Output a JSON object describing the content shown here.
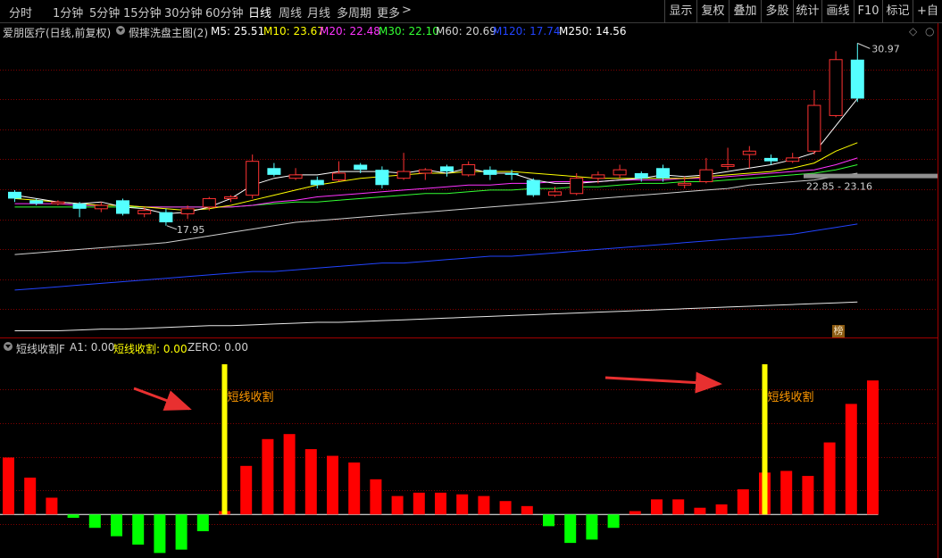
{
  "toolbar": {
    "periods": [
      "分时",
      "1分钟",
      "5分钟",
      "15分钟",
      "30分钟",
      "60分钟",
      "日线",
      "周线",
      "月线",
      "多周期",
      "更多"
    ],
    "active_period": "日线",
    "more_arrow": ">",
    "right_buttons": [
      "显示",
      "复权",
      "叠加",
      "多股",
      "统计",
      "画线",
      "F10",
      "标记",
      "+自选"
    ]
  },
  "main_header": {
    "stock": "爱朋医疗(日线,前复权)",
    "indicator": "假摔洗盘主图(2)",
    "ma": [
      {
        "label": "M5: 25.51",
        "color": "#ffffff"
      },
      {
        "label": "M10: 23.67",
        "color": "#ffff00"
      },
      {
        "label": "M20: 22.48",
        "color": "#ff33ff"
      },
      {
        "label": "M30: 22.10",
        "color": "#33ff33"
      },
      {
        "label": "M60: 20.69",
        "color": "#d0d0d0"
      },
      {
        "label": "M120: 17.74",
        "color": "#2244ff"
      },
      {
        "label": "M250: 14.56",
        "color": "#ffffff"
      }
    ],
    "collapse_icon": "diamond-icon"
  },
  "price_labels": {
    "high": "30.97",
    "low": "17.95",
    "range": "22.85 - 23.16",
    "badge": "榜"
  },
  "sub_header": {
    "name": "短线收割F",
    "a1": "A1: 0.00",
    "sx": "短线收割: 0.00",
    "zero": "ZERO: 0.00"
  },
  "signal_label": "短线收割",
  "colors": {
    "up": "#ff3232",
    "down": "#54ffff",
    "macd_up": "#ff0000",
    "macd_down": "#00ff00",
    "signal": "#ffff00",
    "grid": "#800000"
  },
  "chart_data": {
    "type": "candlestick",
    "candles": [
      {
        "o": 22.2,
        "c": 21.8,
        "h": 22.3,
        "l": 21.6
      },
      {
        "o": 21.7,
        "c": 21.5,
        "h": 21.8,
        "l": 21.4
      },
      {
        "o": 21.5,
        "c": 21.6,
        "h": 21.7,
        "l": 21.4
      },
      {
        "o": 21.5,
        "c": 21.2,
        "h": 21.6,
        "l": 20.7
      },
      {
        "o": 21.2,
        "c": 21.4,
        "h": 21.6,
        "l": 21.0
      },
      {
        "o": 21.7,
        "c": 20.9,
        "h": 21.8,
        "l": 20.8
      },
      {
        "o": 20.9,
        "c": 21.1,
        "h": 21.3,
        "l": 20.7
      },
      {
        "o": 21.0,
        "c": 20.4,
        "h": 21.2,
        "l": 20.2
      },
      {
        "o": 20.9,
        "c": 21.2,
        "h": 21.4,
        "l": 20.6
      },
      {
        "o": 21.3,
        "c": 21.8,
        "h": 21.9,
        "l": 21.1
      },
      {
        "o": 21.8,
        "c": 21.9,
        "h": 22.0,
        "l": 21.6
      },
      {
        "o": 22.0,
        "c": 24.0,
        "h": 24.4,
        "l": 21.8
      },
      {
        "o": 23.6,
        "c": 23.2,
        "h": 23.9,
        "l": 23.1
      },
      {
        "o": 23.0,
        "c": 23.2,
        "h": 23.6,
        "l": 22.9
      },
      {
        "o": 22.9,
        "c": 22.6,
        "h": 23.1,
        "l": 22.4
      },
      {
        "o": 22.9,
        "c": 23.3,
        "h": 24.0,
        "l": 22.8
      },
      {
        "o": 23.8,
        "c": 23.5,
        "h": 23.9,
        "l": 23.3
      },
      {
        "o": 23.5,
        "c": 22.6,
        "h": 23.7,
        "l": 22.4
      },
      {
        "o": 23.0,
        "c": 23.4,
        "h": 24.5,
        "l": 22.9
      },
      {
        "o": 23.3,
        "c": 23.5,
        "h": 23.6,
        "l": 22.9
      },
      {
        "o": 23.7,
        "c": 23.4,
        "h": 23.8,
        "l": 23.1
      },
      {
        "o": 23.2,
        "c": 23.8,
        "h": 24.0,
        "l": 23.1
      },
      {
        "o": 23.5,
        "c": 23.2,
        "h": 23.7,
        "l": 22.9
      },
      {
        "o": 23.3,
        "c": 23.2,
        "h": 23.5,
        "l": 22.9
      },
      {
        "o": 22.9,
        "c": 22.0,
        "h": 23.0,
        "l": 21.9
      },
      {
        "o": 22.0,
        "c": 22.2,
        "h": 22.5,
        "l": 21.9
      },
      {
        "o": 22.1,
        "c": 23.0,
        "h": 23.3,
        "l": 22.0
      },
      {
        "o": 23.0,
        "c": 23.2,
        "h": 23.4,
        "l": 22.7
      },
      {
        "o": 23.2,
        "c": 23.5,
        "h": 23.8,
        "l": 23.0
      },
      {
        "o": 23.3,
        "c": 23.0,
        "h": 23.4,
        "l": 22.8
      },
      {
        "o": 23.6,
        "c": 23.0,
        "h": 23.8,
        "l": 22.8
      },
      {
        "o": 22.6,
        "c": 22.7,
        "h": 23.1,
        "l": 22.4
      },
      {
        "o": 22.8,
        "c": 23.5,
        "h": 24.2,
        "l": 22.7
      },
      {
        "o": 23.7,
        "c": 23.8,
        "h": 24.8,
        "l": 23.5
      },
      {
        "o": 24.4,
        "c": 24.6,
        "h": 24.9,
        "l": 23.6
      },
      {
        "o": 24.2,
        "c": 24.0,
        "h": 24.4,
        "l": 23.8
      },
      {
        "o": 24.0,
        "c": 24.2,
        "h": 24.5,
        "l": 23.9
      },
      {
        "o": 24.6,
        "c": 27.3,
        "h": 28.2,
        "l": 24.4
      },
      {
        "o": 26.7,
        "c": 30.0,
        "h": 30.5,
        "l": 26.6
      },
      {
        "o": 30.0,
        "c": 27.7,
        "h": 30.97,
        "l": 27.5
      }
    ],
    "ma5": [
      22.0,
      21.8,
      21.6,
      21.5,
      21.6,
      21.3,
      21.2,
      20.9,
      21.0,
      21.3,
      21.8,
      22.6,
      23.0,
      23.2,
      23.2,
      23.4,
      23.4,
      23.4,
      23.3,
      23.5,
      23.3,
      23.6,
      23.3,
      23.3,
      22.9,
      22.7,
      22.7,
      22.8,
      22.9,
      23.0,
      23.2,
      23.1,
      23.2,
      23.4,
      23.6,
      23.8,
      24.1,
      24.5,
      26.1,
      27.7
    ],
    "ma10": [
      21.8,
      21.7,
      21.6,
      21.5,
      21.4,
      21.4,
      21.3,
      21.2,
      21.1,
      21.2,
      21.4,
      21.7,
      22.0,
      22.3,
      22.6,
      22.8,
      23.0,
      23.1,
      23.2,
      23.3,
      23.3,
      23.4,
      23.4,
      23.4,
      23.3,
      23.2,
      23.1,
      23.0,
      23.0,
      23.0,
      23.0,
      23.0,
      23.1,
      23.2,
      23.3,
      23.4,
      23.6,
      23.9,
      24.6,
      25.1
    ],
    "ma20": [
      21.5,
      21.5,
      21.5,
      21.4,
      21.4,
      21.4,
      21.3,
      21.3,
      21.3,
      21.3,
      21.3,
      21.4,
      21.6,
      21.7,
      21.9,
      22.0,
      22.1,
      22.2,
      22.3,
      22.4,
      22.5,
      22.6,
      22.6,
      22.7,
      22.7,
      22.8,
      22.8,
      22.8,
      22.9,
      22.9,
      22.9,
      23.0,
      23.0,
      23.1,
      23.2,
      23.3,
      23.4,
      23.5,
      23.8,
      24.2
    ],
    "ma30": [
      21.3,
      21.3,
      21.3,
      21.3,
      21.3,
      21.3,
      21.3,
      21.3,
      21.3,
      21.3,
      21.3,
      21.4,
      21.5,
      21.6,
      21.6,
      21.7,
      21.8,
      21.9,
      22.0,
      22.1,
      22.1,
      22.2,
      22.3,
      22.3,
      22.4,
      22.4,
      22.5,
      22.5,
      22.6,
      22.7,
      22.7,
      22.8,
      22.8,
      22.9,
      23.0,
      23.1,
      23.2,
      23.3,
      23.5,
      23.8
    ],
    "ma60": [
      18.5,
      18.6,
      18.7,
      18.8,
      18.9,
      19.0,
      19.1,
      19.2,
      19.4,
      19.6,
      19.8,
      20.0,
      20.2,
      20.4,
      20.5,
      20.6,
      20.7,
      20.8,
      20.9,
      21.0,
      21.1,
      21.2,
      21.3,
      21.4,
      21.5,
      21.6,
      21.7,
      21.8,
      21.9,
      22.0,
      22.1,
      22.2,
      22.3,
      22.4,
      22.6,
      22.7,
      22.8,
      22.9,
      23.1,
      23.3
    ],
    "ma120": [
      16.4,
      16.5,
      16.6,
      16.7,
      16.8,
      16.9,
      17.0,
      17.1,
      17.2,
      17.3,
      17.4,
      17.5,
      17.5,
      17.6,
      17.7,
      17.8,
      17.9,
      18.0,
      18.0,
      18.1,
      18.2,
      18.3,
      18.4,
      18.4,
      18.5,
      18.6,
      18.7,
      18.8,
      18.9,
      19.0,
      19.1,
      19.2,
      19.3,
      19.4,
      19.5,
      19.6,
      19.7,
      19.9,
      20.1,
      20.3
    ],
    "ma250": [
      14.0,
      14.0,
      14.0,
      14.05,
      14.1,
      14.1,
      14.15,
      14.2,
      14.25,
      14.3,
      14.3,
      14.35,
      14.4,
      14.45,
      14.5,
      14.5,
      14.55,
      14.6,
      14.65,
      14.7,
      14.75,
      14.8,
      14.85,
      14.9,
      14.95,
      15.0,
      15.05,
      15.1,
      15.15,
      15.2,
      15.25,
      15.3,
      15.35,
      15.4,
      15.45,
      15.5,
      15.55,
      15.6,
      15.65,
      15.7
    ],
    "price_range": [
      13.5,
      31.2
    ],
    "osc": [
      3.4,
      2.2,
      1.0,
      -0.2,
      -0.8,
      -1.3,
      -1.8,
      -2.3,
      -2.1,
      -1.0,
      0.2,
      2.9,
      4.5,
      4.8,
      3.9,
      3.5,
      3.1,
      2.1,
      1.1,
      1.3,
      1.3,
      1.2,
      1.1,
      0.8,
      0.5,
      -0.7,
      -1.7,
      -1.5,
      -0.8,
      0.2,
      0.9,
      0.9,
      0.4,
      0.6,
      1.5,
      2.5,
      2.6,
      2.3,
      4.3,
      6.6,
      8.0
    ],
    "osc_range": [
      -2.6,
      9.5
    ],
    "signal_index": [
      10,
      35
    ]
  }
}
